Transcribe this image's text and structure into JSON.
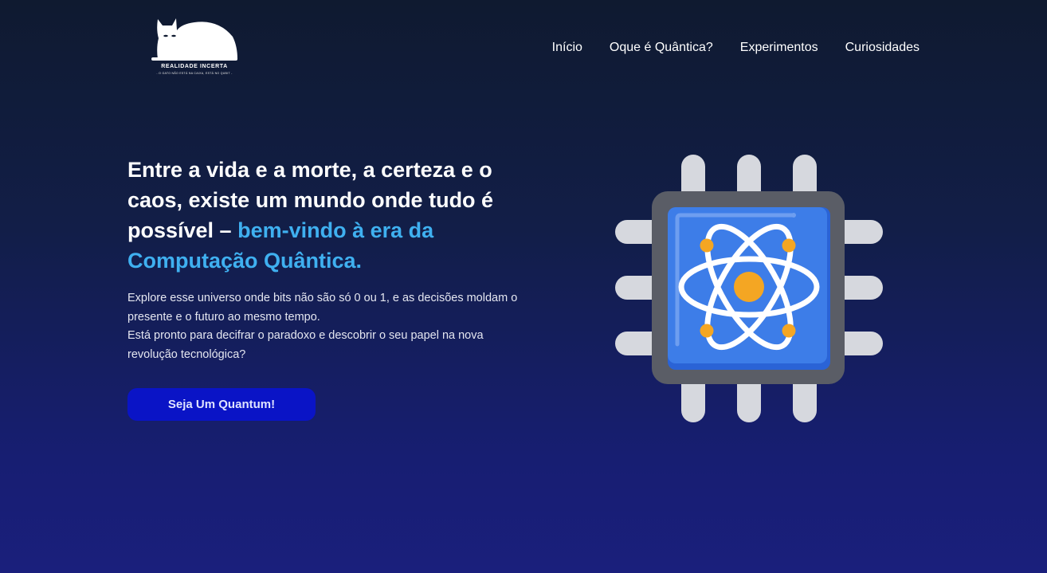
{
  "brand": {
    "name": "REALIDADE INCERTA",
    "tagline": "- O GATO NÃO ESTÁ NA CAIXA, ESTÁ NO QUBIT -"
  },
  "nav": {
    "items": [
      {
        "label": "Início"
      },
      {
        "label": "Oque é Quântica?"
      },
      {
        "label": "Experimentos"
      },
      {
        "label": "Curiosidades"
      }
    ]
  },
  "hero": {
    "headline_main": "Entre a vida e a morte, a certeza e o caos, existe um mundo onde tudo é possível – ",
    "headline_accent": "bem-vindo à era da Computação Quântica.",
    "description_1": "Explore esse universo onde bits não são só 0 ou 1, e as decisões moldam o presente e o futuro ao mesmo tempo.",
    "description_2": "Está pronto para decifrar o paradoxo e descobrir o seu papel na nova revolução tecnológica?",
    "cta_label": "Seja Um Quantum!"
  },
  "illustration": {
    "icon": "quantum-chip-icon",
    "colors": {
      "chip_body": "#5a5d66",
      "chip_core": "#3d7de8",
      "pins": "#d6d8de",
      "orbits": "#ffffff",
      "nucleus": "#f4a623"
    }
  },
  "colors": {
    "background_top": "#0f1a30",
    "background_bottom": "#1a1f7c",
    "accent": "#3fb0f0",
    "button": "#0a14c6"
  }
}
